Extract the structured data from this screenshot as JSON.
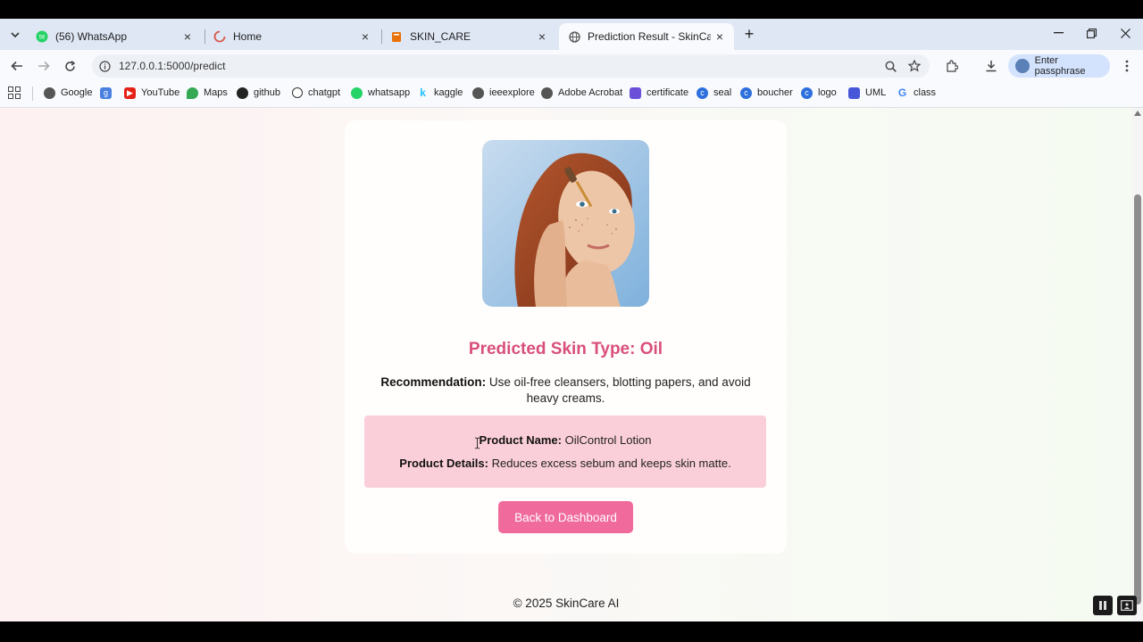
{
  "browser": {
    "tabs": [
      {
        "title": "(56) WhatsApp",
        "icon": "whatsapp-icon",
        "badge": "56"
      },
      {
        "title": "Home",
        "icon": "loading-spinner-icon"
      },
      {
        "title": "SKIN_CARE",
        "icon": "book-icon"
      },
      {
        "title": "Prediction Result - SkinCare AI",
        "icon": "globe-icon",
        "active": true
      }
    ],
    "url": "127.0.0.1:5000/predict",
    "profile_label": "Enter passphrase",
    "bookmarks": [
      {
        "label": "Google",
        "icon": "globe-icon"
      },
      {
        "label": "",
        "icon": "google-g-icon"
      },
      {
        "label": "YouTube",
        "icon": "youtube-icon"
      },
      {
        "label": "Maps",
        "icon": "maps-pin-icon"
      },
      {
        "label": "github",
        "icon": "github-icon"
      },
      {
        "label": "chatgpt",
        "icon": "chatgpt-icon"
      },
      {
        "label": "whatsapp",
        "icon": "whatsapp-icon"
      },
      {
        "label": "kaggle",
        "icon": "kaggle-icon"
      },
      {
        "label": "ieeexplore",
        "icon": "globe-icon"
      },
      {
        "label": "Adobe Acrobat",
        "icon": "globe-icon"
      },
      {
        "label": "certificate",
        "icon": "certificate-icon"
      },
      {
        "label": "seal",
        "icon": "canva-icon"
      },
      {
        "label": "boucher",
        "icon": "canva-icon"
      },
      {
        "label": "logo",
        "icon": "canva-icon"
      },
      {
        "label": "UML",
        "icon": "uml-icon"
      },
      {
        "label": "class",
        "icon": "google-g-icon"
      }
    ]
  },
  "page": {
    "headline": "Predicted Skin Type: Oil",
    "recommendation_label": "Recommendation:",
    "recommendation_text": " Use oil-free cleansers, blotting papers, and avoid heavy creams.",
    "product_name_label": "Product Name:",
    "product_name": " OilControl Lotion",
    "product_details_label": "Product Details:",
    "product_details": " Reduces excess sebum and keeps skin matte.",
    "back_button": "Back to Dashboard",
    "footer": "© 2025 SkinCare AI"
  },
  "colors": {
    "accent_pink": "#d94f7a",
    "button_pink": "#f06a9c",
    "product_box": "#fbcfda"
  }
}
